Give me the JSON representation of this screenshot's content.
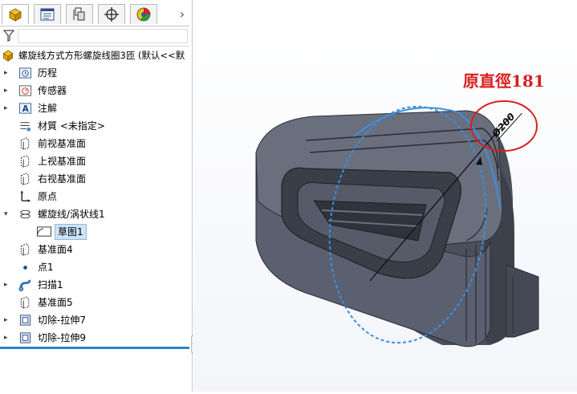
{
  "feature_tree": {
    "tabs": [
      {
        "name": "featuremanager-tab",
        "icon": "featuremanager-icon",
        "active": true
      },
      {
        "name": "propertymanager-tab",
        "icon": "propertymanager-icon",
        "active": false
      },
      {
        "name": "configurationmanager-tab",
        "icon": "configurationmanager-icon",
        "active": false
      },
      {
        "name": "dimxpert-tab",
        "icon": "dimxpert-icon",
        "active": false
      },
      {
        "name": "display-manager-tab",
        "icon": "display-manager-icon",
        "active": false
      }
    ],
    "more_glyph": "›",
    "root_label": "螺旋线方式方形螺旋线圈3匝 (默认<<默",
    "items": [
      {
        "label": "历程",
        "icon": "history-icon"
      },
      {
        "label": "传感器",
        "icon": "sensor-icon"
      },
      {
        "label": "注解",
        "icon": "annotation-icon"
      },
      {
        "label": "材質 <未指定>",
        "icon": "material-icon"
      },
      {
        "label": "前视基准面",
        "icon": "plane-icon"
      },
      {
        "label": "上视基准面",
        "icon": "plane-icon"
      },
      {
        "label": "右视基准面",
        "icon": "plane-icon"
      },
      {
        "label": "原点",
        "icon": "origin-icon"
      },
      {
        "label": "螺旋线/涡状线1",
        "icon": "helix-icon"
      },
      {
        "label": "草图1",
        "icon": "sketch-icon"
      },
      {
        "label": "基准面4",
        "icon": "plane-icon"
      },
      {
        "label": "点1",
        "icon": "point-icon"
      },
      {
        "label": "扫描1",
        "icon": "sweep-icon"
      },
      {
        "label": "基准面5",
        "icon": "plane-icon"
      },
      {
        "label": "切除-拉伸7",
        "icon": "cut-extrude-icon"
      },
      {
        "label": "切除-拉伸9",
        "icon": "cut-extrude-icon"
      }
    ]
  },
  "viewport": {
    "annotation": "原直徑181",
    "dimension_label": "Ø200",
    "accent_red": "#d81e1e",
    "helix_blue": "#3b8fe0",
    "part_color": "#5a5f6e"
  }
}
